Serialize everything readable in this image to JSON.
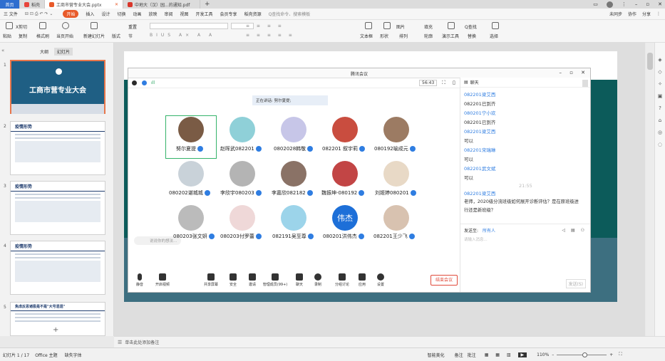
{
  "tabs": [
    {
      "label": "首页"
    },
    {
      "label": "稻壳"
    },
    {
      "label": "工商市营专业大会.pptx"
    },
    {
      "label": "中地大（汉）园...的通知.pdf"
    }
  ],
  "menu": [
    "三 文件",
    "开始",
    "插入",
    "设计",
    "切换",
    "动画",
    "放映",
    "审阅",
    "视图",
    "开发工具",
    "会员专享",
    "稻壳资源"
  ],
  "menu_active": "开始",
  "search_placeholder": "Q查找命令、搜索模板",
  "top_right": [
    "未同步",
    "协作",
    "分享"
  ],
  "ribbon": {
    "paste": "粘贴",
    "cut": "X剪切",
    "copy": "复制",
    "format_painter": "格式刷",
    "from_current": "当页开始",
    "new_slide": "新建幻灯片",
    "layout": "版式",
    "section": "节",
    "reset": "重置",
    "text_box": "文本框",
    "shape": "形状",
    "arrange": "排列",
    "image": "图片",
    "fill": "填充",
    "outline": "轮廓",
    "presenter": "演示工具",
    "find": "Q查找",
    "replace": "替换",
    "select": "选择"
  },
  "leftpanel": {
    "tabs": [
      "大纲",
      "幻灯片"
    ],
    "active_tab": "幻灯片"
  },
  "slides": [
    {
      "num": "1",
      "title": "工商市营专业大会"
    },
    {
      "num": "2",
      "title": "疫情形势"
    },
    {
      "num": "3",
      "title": "疫情形势"
    },
    {
      "num": "4",
      "title": "疫情形势"
    },
    {
      "num": "5",
      "title": "焦虑反思诸极是不是\"大号混混\""
    }
  ],
  "meeting": {
    "title": "腾讯会议",
    "time": "56:43",
    "speaking": "正在讲话: 努尔夏提;",
    "participants": [
      {
        "name": "努尔夏提",
        "color": "#7a5b45"
      },
      {
        "name": "赵晖武082201",
        "color": "#8fd0d8"
      },
      {
        "name": "0802028韩敬",
        "color": "#c7c6e8"
      },
      {
        "name": "082201 叙宇莉",
        "color": "#c94d3f"
      },
      {
        "name": "080192喻成元",
        "color": "#9c7b63"
      },
      {
        "name": "080202谌城城",
        "color": "#c9d2d9"
      },
      {
        "name": "李欣宇080203",
        "color": "#b4b4b4"
      },
      {
        "name": "李嘉欣082182",
        "color": "#8a7266"
      },
      {
        "name": "魏振坤-080192",
        "color": "#c24545"
      },
      {
        "name": "刘姬婷080201",
        "color": "#e8d9c6"
      },
      {
        "name": "080203张文妍",
        "color": "#bbbbbb"
      },
      {
        "name": "080203付罗蕾",
        "color": "#efd8d8"
      },
      {
        "name": "082191吴至尊",
        "color": "#9cd4ea"
      },
      {
        "name": "080201洪伟杰",
        "color": "#1d6fd8",
        "text": "伟杰"
      },
      {
        "name": "082201王少飞",
        "color": "#d8c2b0"
      }
    ],
    "reply_placeholder": "说说你的想法...",
    "toolbar": [
      "静音",
      "开启视频",
      "共享屏幕",
      "安全",
      "邀请",
      "管理成员(99+)",
      "聊天",
      "录制",
      "分组讨论",
      "应用",
      "设置"
    ],
    "end_button": "结束会议",
    "chat": {
      "header": "聊天",
      "messages": [
        {
          "text": "082201梁艾西",
          "sender": true
        },
        {
          "text": "082201已到齐",
          "sender": false
        },
        {
          "text": "080201宁小欢",
          "sender": true
        },
        {
          "text": "082201已到齐",
          "sender": false
        },
        {
          "text": "082201梁艾西",
          "sender": true
        },
        {
          "text": "可以",
          "sender": false
        },
        {
          "text": "082201宋瑞琳",
          "sender": true
        },
        {
          "text": "可以",
          "sender": false
        },
        {
          "text": "082201武文斌",
          "sender": true
        },
        {
          "text": "可以",
          "sender": false
        }
      ],
      "timestamp": "21:55",
      "last_sender": "082201梁艾西",
      "last_message_1": "老师，2020级分流班级如何展开诊断评估？是在原班级进",
      "last_message_2": "行还是新班级？",
      "send_to_label": "发送至:",
      "send_to": "所有人",
      "input_placeholder": "请输入消息...",
      "send_button": "发送(S)"
    }
  },
  "notes": "单击此处添加备注",
  "status": {
    "slide_count": "幻灯片 1 / 17",
    "theme": "Office 主题",
    "font_missing": "缺失字体",
    "smart_beautify": "智能美化",
    "notes": "备注",
    "comments": "批注",
    "zoom": "110%"
  }
}
